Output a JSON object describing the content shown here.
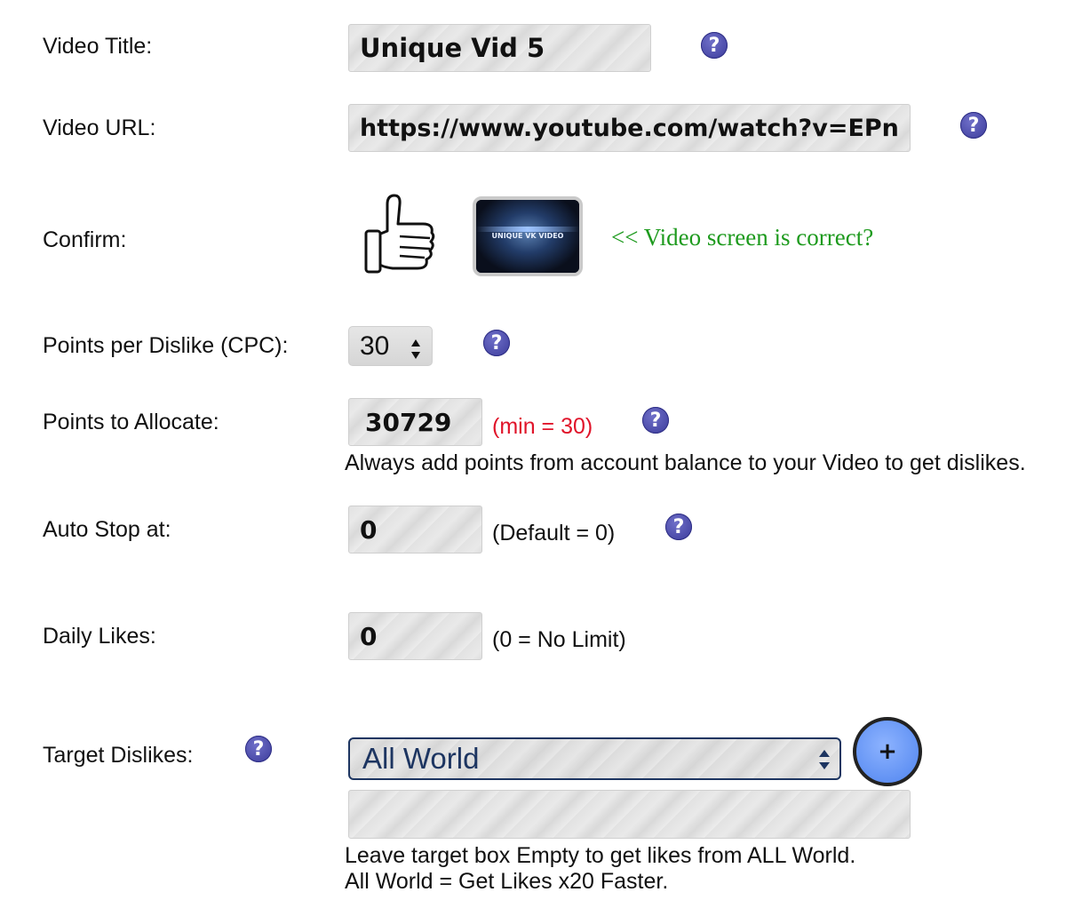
{
  "video_title": {
    "label": "Video Title:",
    "value": "Unique Vid 5"
  },
  "video_url": {
    "label": "Video URL:",
    "value": "https://www.youtube.com/watch?v=EPn"
  },
  "confirm": {
    "label": "Confirm:",
    "thumbnail_text": "UNIQUE VK VIDEO",
    "message": "<< Video screen is correct?"
  },
  "points_per_dislike": {
    "label": "Points per Dislike (CPC):",
    "value": "30"
  },
  "points_to_allocate": {
    "label": "Points to Allocate:",
    "value": "30729",
    "min_note": "(min = 30)",
    "hint": "Always add points from account balance to your Video to get dislikes."
  },
  "auto_stop": {
    "label": "Auto Stop at:",
    "value": "0",
    "note": "(Default = 0)"
  },
  "daily_likes": {
    "label": "Daily Likes:",
    "value": "0",
    "note": "(0 = No Limit)"
  },
  "target_dislikes": {
    "label": "Target Dislikes:",
    "selected": "All World",
    "add_label": "+",
    "target_box_value": "",
    "hint_line1": "Leave target box Empty to get likes from ALL World.",
    "hint_line2": "All World = Get Likes x20 Faster."
  },
  "help_glyph": "?",
  "icons": [
    "help-icon",
    "thumbs-up-icon",
    "select-arrows-icon",
    "spinner-arrows-icon",
    "add-icon"
  ],
  "colors": {
    "help": "#3a3a9a",
    "note_red": "#e0142a",
    "confirm_green": "#1d9a1d",
    "select_text": "#1d3561",
    "add_button": "#4f84ef"
  }
}
